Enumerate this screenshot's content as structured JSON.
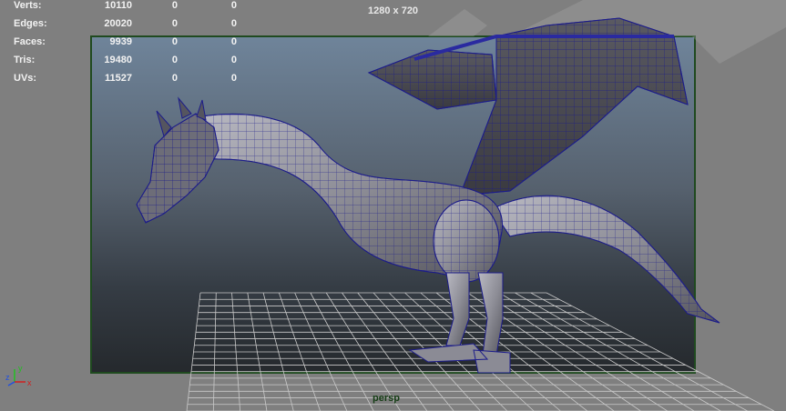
{
  "hud": {
    "stats": [
      {
        "label": "Verts:",
        "values": [
          "10110",
          "0",
          "0"
        ]
      },
      {
        "label": "Edges:",
        "values": [
          "20020",
          "0",
          "0"
        ]
      },
      {
        "label": "Faces:",
        "values": [
          "9939",
          "0",
          "0"
        ]
      },
      {
        "label": "Tris:",
        "values": [
          "19480",
          "0",
          "0"
        ]
      },
      {
        "label": "UVs:",
        "values": [
          "11527",
          "0",
          "0"
        ]
      }
    ]
  },
  "viewport": {
    "resolution_label": "1280 x 720",
    "camera_label": "persp"
  },
  "axis": {
    "x": "x",
    "y": "y",
    "z": "z"
  },
  "colors": {
    "hud_text": "#f2f2f2",
    "gate_border": "#1f4a1f",
    "wireframe": "#1c1c8a",
    "camera_label": "#143c14",
    "axis_x": "#d02020",
    "axis_y": "#20c020",
    "axis_z": "#2050e0"
  }
}
